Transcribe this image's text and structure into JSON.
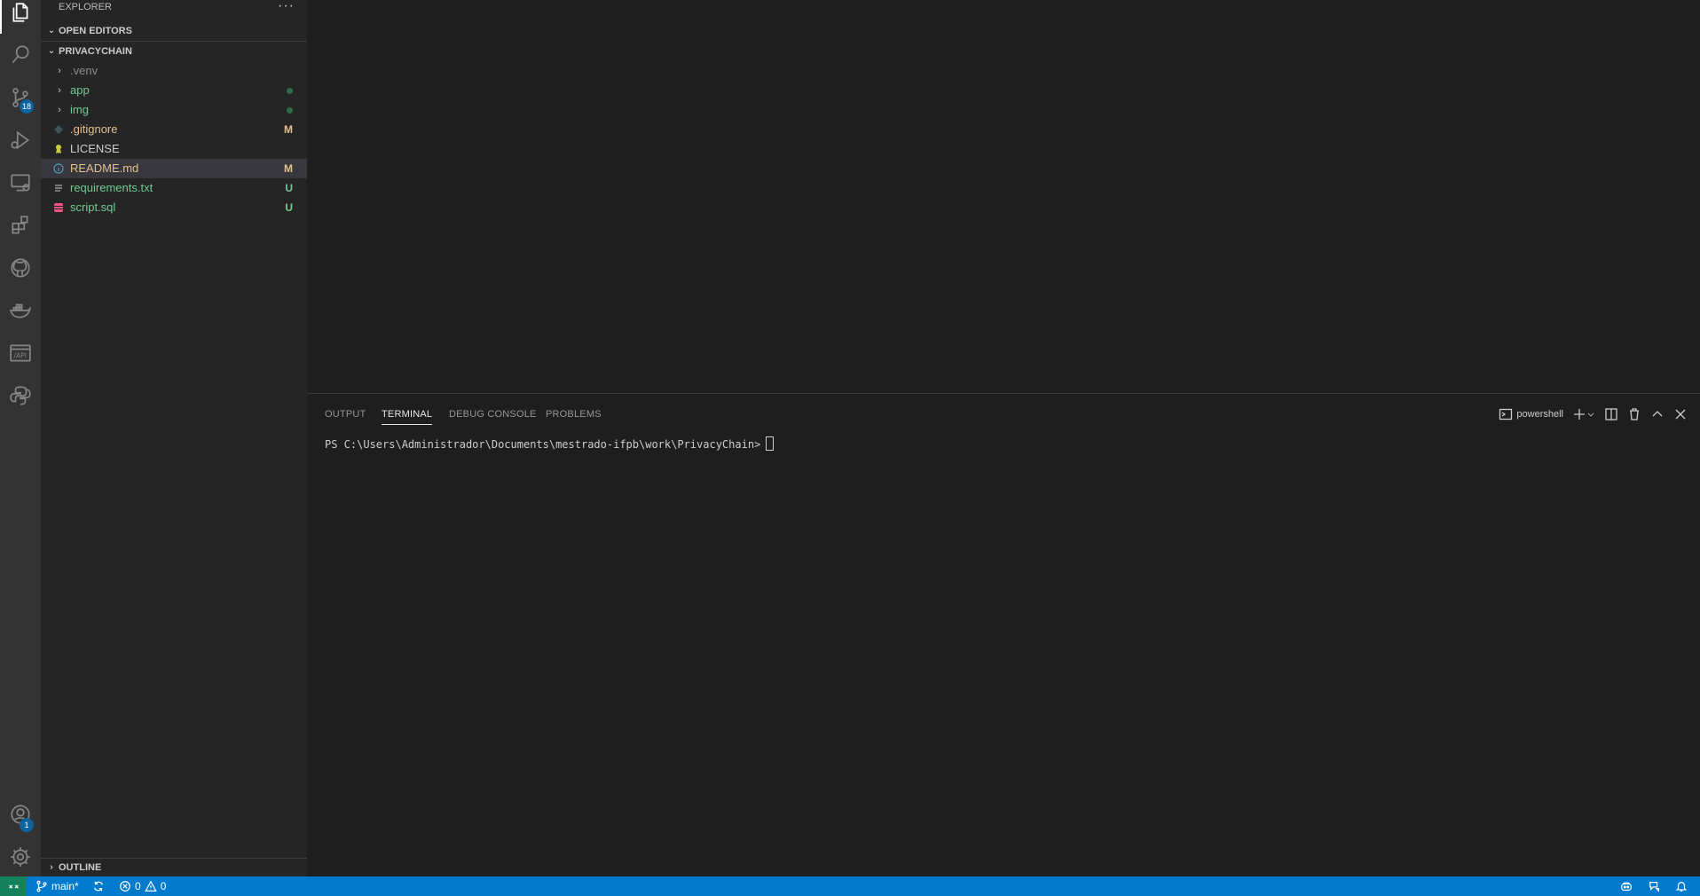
{
  "activity_bar": {
    "items": [
      {
        "name": "explorer",
        "icon": "files-icon"
      },
      {
        "name": "search",
        "icon": "search-icon"
      },
      {
        "name": "source-control",
        "icon": "source-control-icon",
        "badge": "18"
      },
      {
        "name": "run-debug",
        "icon": "run-debug-icon"
      },
      {
        "name": "remote-explorer",
        "icon": "remote-explorer-icon"
      },
      {
        "name": "extensions",
        "icon": "extensions-icon"
      },
      {
        "name": "github",
        "icon": "github-icon"
      },
      {
        "name": "docker",
        "icon": "docker-icon"
      },
      {
        "name": "api",
        "icon": "api-icon",
        "text": "/API"
      },
      {
        "name": "python",
        "icon": "python-icon"
      }
    ],
    "accounts": {
      "icon": "account-icon",
      "badge": "1"
    },
    "settings": {
      "icon": "gear-icon"
    }
  },
  "sidebar": {
    "title": "EXPLORER",
    "more_icon": "ellipsis-icon",
    "open_editors": "OPEN EDITORS",
    "project": "PRIVACYCHAIN",
    "outline": "OUTLINE",
    "files": [
      {
        "name": ".venv",
        "type": "folder",
        "status": "ignored"
      },
      {
        "name": "app",
        "type": "folder",
        "status": "dot"
      },
      {
        "name": "img",
        "type": "folder",
        "status": "dot"
      },
      {
        "name": ".gitignore",
        "type": "file",
        "icon": "gitignore-icon",
        "decoration": "M"
      },
      {
        "name": "LICENSE",
        "type": "file",
        "icon": "license-icon"
      },
      {
        "name": "README.md",
        "type": "file",
        "icon": "info-icon",
        "decoration": "M",
        "selected": true
      },
      {
        "name": "requirements.txt",
        "type": "file",
        "icon": "text-file-icon",
        "decoration": "U"
      },
      {
        "name": "script.sql",
        "type": "file",
        "icon": "database-icon",
        "decoration": "U"
      }
    ]
  },
  "panel": {
    "tabs": [
      "OUTPUT",
      "TERMINAL",
      "DEBUG CONSOLE",
      "PROBLEMS"
    ],
    "active_tab": "TERMINAL",
    "shell_label": "powershell",
    "terminal_prompt": "PS C:\\Users\\Administrador\\Documents\\mestrado-ifpb\\work\\PrivacyChain>"
  },
  "status_bar": {
    "branch": "main*",
    "errors": "0",
    "warnings": "0"
  },
  "colors": {
    "status_bar": "#007acc",
    "remote": "#16825d",
    "untracked": "#73c991",
    "modified": "#e2c08d"
  }
}
